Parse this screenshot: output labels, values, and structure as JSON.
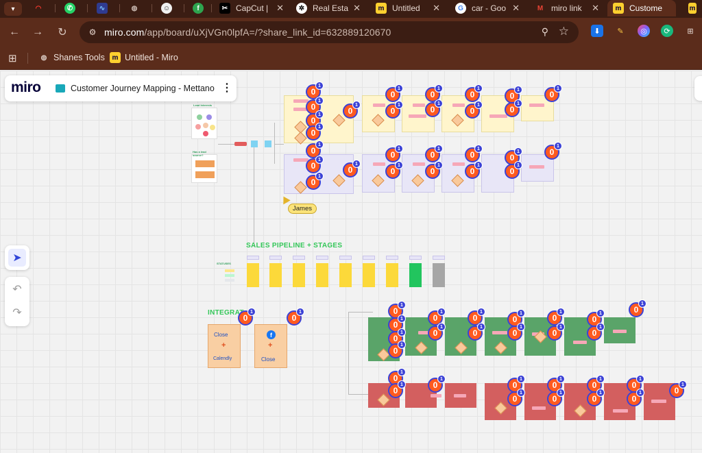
{
  "browser": {
    "tabs": [
      {
        "label": "",
        "icon": "red-arc-icon"
      },
      {
        "label": "",
        "icon": "whatsapp-icon"
      },
      {
        "label": "",
        "icon": "pulse-icon"
      },
      {
        "label": "",
        "icon": "globe-icon"
      },
      {
        "label": "",
        "icon": "emoji-icon"
      },
      {
        "label": "",
        "icon": "fb-green-icon"
      },
      {
        "label": "CapCut |",
        "icon": "capcut-icon"
      },
      {
        "label": "Real Esta",
        "icon": "openai-icon"
      },
      {
        "label": "Untitled",
        "icon": "miro-icon"
      },
      {
        "label": "car - Goo",
        "icon": "google-icon"
      },
      {
        "label": "miro link",
        "icon": "gmail-icon"
      },
      {
        "label": "Custome",
        "icon": "miro-icon"
      }
    ],
    "url_main": "miro.com",
    "url_rest": "/app/board/uXjVGn0lpfA=/?share_link_id=632889120670",
    "bookmarks": [
      {
        "label": "Shanes Tools",
        "icon": "globe-icon"
      },
      {
        "label": "Untitled - Miro",
        "icon": "miro-icon"
      }
    ]
  },
  "board": {
    "title": "Customer Journey Mapping - Mettano",
    "logo": "miro",
    "sales_heading": "SALES PIPELINE + STAGES",
    "integrations_heading": "INTEGRAT",
    "statuses_label": "STATUSES",
    "lead_label": "Lead Interests",
    "source_label": "Has a lead source?",
    "close_label": "Close",
    "calendly_label": "Calendly",
    "cursor_user": "James",
    "badge_value": "0",
    "badge_count": "1"
  },
  "colors": {
    "chrome_dark": "#3b1d13",
    "chrome_mid": "#5b2c1b",
    "badge": "#ff5a1f",
    "badge_ring": "#3c42d6",
    "yellow_sticky": "#fff5cc",
    "lilac_sticky": "#e8e6f7",
    "green_sticky": "#5aa469",
    "red_sticky": "#d35f5f",
    "stage_yellow": "#fcd93a",
    "stage_green": "#22c55e",
    "stage_grey": "#a6a6a6"
  }
}
